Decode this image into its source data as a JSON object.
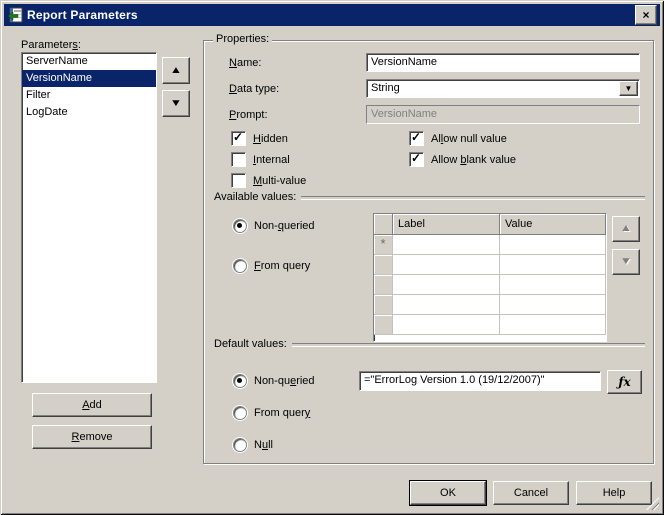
{
  "window": {
    "title": "Report Parameters"
  },
  "colors": {
    "titlebar": "#0a246a",
    "selection": "#0a246a",
    "dialog_bg": "#d4d0c8",
    "disabled_text": "#808080"
  },
  "icons": {
    "close": "×",
    "up_arrow": "▲",
    "down_arrow": "▼",
    "dropdown_arrow": "▼",
    "fx": "ƒx",
    "new_row_marker": "*"
  },
  "parameters_panel": {
    "label": {
      "pre": "Parameter",
      "key": "s",
      "post": ":"
    },
    "items": [
      "ServerName",
      "VersionName",
      "Filter",
      "LogDate"
    ],
    "selected_index": 1,
    "add": {
      "pre": "",
      "key": "A",
      "post": "dd"
    },
    "remove": {
      "pre": "",
      "key": "R",
      "post": "emove"
    }
  },
  "properties": {
    "group_label": "Properties:",
    "name": {
      "label": {
        "pre": "",
        "key": "N",
        "post": "ame:"
      },
      "value": "VersionName"
    },
    "data_type": {
      "label": {
        "pre": "",
        "key": "D",
        "post": "ata type:"
      },
      "value": "String"
    },
    "prompt": {
      "label": {
        "pre": "",
        "key": "P",
        "post": "rompt:"
      },
      "value": "VersionName",
      "disabled": true
    },
    "hidden": {
      "label": {
        "pre": "",
        "key": "H",
        "post": "idden"
      },
      "checked": true
    },
    "internal": {
      "label": {
        "pre": "",
        "key": "I",
        "post": "nternal"
      },
      "checked": false
    },
    "multi_value": {
      "label": {
        "pre": "",
        "key": "M",
        "post": "ulti-value"
      },
      "checked": false
    },
    "allow_null": {
      "label": {
        "pre": "Al",
        "key": "l",
        "post": "ow null value"
      },
      "checked": true
    },
    "allow_blank": {
      "label": {
        "pre": "Allow ",
        "key": "b",
        "post": "lank value"
      },
      "checked": true
    }
  },
  "available_values": {
    "section_label": "Available values:",
    "non_queried": {
      "label": {
        "pre": "Non-",
        "key": "q",
        "post": "ueried"
      },
      "selected": true
    },
    "from_query": {
      "label": {
        "pre": "",
        "key": "F",
        "post": "rom query"
      },
      "selected": false
    },
    "grid": {
      "columns": [
        "Label",
        "Value"
      ],
      "empty_rows": 4
    }
  },
  "default_values": {
    "section_label": "Default values:",
    "non_queried": {
      "label": {
        "pre": "Non-qu",
        "key": "e",
        "post": "ried"
      },
      "selected": true
    },
    "from_query": {
      "label": {
        "pre": "From quer",
        "key": "y",
        "post": ""
      },
      "selected": false
    },
    "null_option": {
      "label": {
        "pre": "N",
        "key": "u",
        "post": "ll"
      },
      "selected": false
    },
    "value": "=\"ErrorLog Version 1.0 (19/12/2007)\""
  },
  "footer": {
    "ok": "OK",
    "cancel": "Cancel",
    "help": "Help"
  }
}
